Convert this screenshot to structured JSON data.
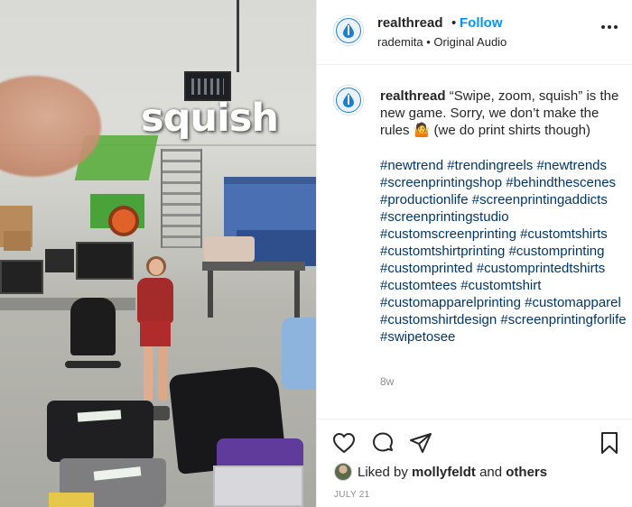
{
  "media": {
    "overlay_text": "squish"
  },
  "post": {
    "username": "realthread",
    "separator": "•",
    "follow_label": "Follow",
    "audio_line": "rademita • Original Audio",
    "caption_user": "realthread",
    "caption_text": "“Swipe, zoom, squish” is the new game. Sorry, we don’t make the rules 🤷 (we do print shirts though)",
    "hashtags": [
      "#newtrend",
      "#trendingreels",
      "#newtrends",
      "#screenprintingshop",
      "#behindthescenes",
      "#productionlife",
      "#screenprintingaddicts",
      "#screenprintingstudio",
      "#customscreenprinting",
      "#customtshirts",
      "#customtshirtprinting",
      "#customprinting",
      "#customprinted",
      "#customprintedtshirts",
      "#customtees",
      "#customtshirt",
      "#customapparelprinting",
      "#customapparel",
      "#customshirtdesign",
      "#screenprintingforlife",
      "#swipetosee"
    ],
    "time_ago": "8w",
    "liked_by_prefix": "Liked by",
    "liked_by_user": "mollyfeldt",
    "liked_by_and": "and",
    "liked_by_others": "others",
    "date": "JULY 21"
  },
  "icons": {
    "more": "more-options-icon",
    "like": "heart-icon",
    "comment": "comment-icon",
    "share": "share-icon",
    "save": "bookmark-icon",
    "avatar": "realthread-logo-icon"
  },
  "colors": {
    "link": "#0095f6",
    "hashtag": "#00376b",
    "muted": "#8e8e8e",
    "text": "#262626",
    "brand_avatar": "#1e7fd0"
  }
}
